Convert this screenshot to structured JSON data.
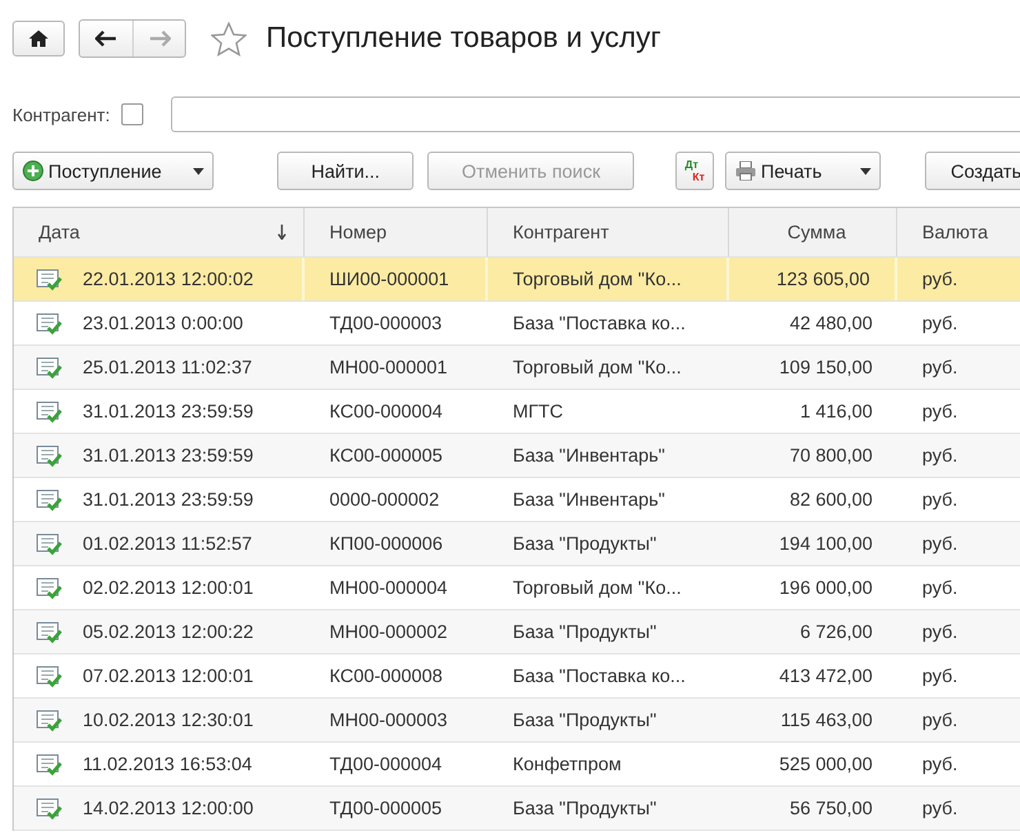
{
  "header": {
    "title": "Поступление товаров и услуг",
    "back_disabled": false,
    "forward_disabled": true,
    "favorite": false
  },
  "filter": {
    "label": "Контрагент:",
    "checked": false
  },
  "toolbar": [
    {
      "kind": "add-menu",
      "label": "Поступление",
      "disabled": false
    },
    {
      "kind": "button",
      "label": "Найти...",
      "disabled": false
    },
    {
      "kind": "button",
      "label": "Отменить поиск",
      "disabled": true
    },
    {
      "kind": "dtkt",
      "label": "Дт",
      "label2": "Кт",
      "disabled": false
    },
    {
      "kind": "print-menu",
      "label": "Печать",
      "disabled": false
    },
    {
      "kind": "button",
      "label": "Создать",
      "disabled": false
    }
  ],
  "table": {
    "columns": [
      {
        "label": "Дата",
        "sorted": true,
        "kind": "text"
      },
      {
        "label": "Номер",
        "sorted": false,
        "kind": "text"
      },
      {
        "label": "Контрагент",
        "sorted": false,
        "kind": "text"
      },
      {
        "label": "Сумма",
        "sorted": false,
        "kind": "number"
      },
      {
        "label": "Валюта",
        "sorted": false,
        "kind": "text"
      }
    ],
    "rows": [
      {
        "selected": true,
        "cells": [
          "22.01.2013 12:00:02",
          "ШИ00-000001",
          "Торговый дом \"Ко...",
          "123 605,00",
          "руб."
        ]
      },
      {
        "selected": false,
        "cells": [
          "23.01.2013 0:00:00",
          "ТД00-000003",
          "База \"Поставка ко...",
          "42 480,00",
          "руб."
        ]
      },
      {
        "selected": false,
        "cells": [
          "25.01.2013 11:02:37",
          "МН00-000001",
          "Торговый дом \"Ко...",
          "109 150,00",
          "руб."
        ]
      },
      {
        "selected": false,
        "cells": [
          "31.01.2013 23:59:59",
          "КС00-000004",
          "МГТС",
          "1 416,00",
          "руб."
        ]
      },
      {
        "selected": false,
        "cells": [
          "31.01.2013 23:59:59",
          "КС00-000005",
          "База \"Инвентарь\"",
          "70 800,00",
          "руб."
        ]
      },
      {
        "selected": false,
        "cells": [
          "31.01.2013 23:59:59",
          "0000-000002",
          "База \"Инвентарь\"",
          "82 600,00",
          "руб."
        ]
      },
      {
        "selected": false,
        "cells": [
          "01.02.2013 11:52:57",
          "КП00-000006",
          "База \"Продукты\"",
          "194 100,00",
          "руб."
        ]
      },
      {
        "selected": false,
        "cells": [
          "02.02.2013 12:00:01",
          "МН00-000004",
          "Торговый дом \"Ко...",
          "196 000,00",
          "руб."
        ]
      },
      {
        "selected": false,
        "cells": [
          "05.02.2013 12:00:22",
          "МН00-000002",
          "База \"Продукты\"",
          "6 726,00",
          "руб."
        ]
      },
      {
        "selected": false,
        "cells": [
          "07.02.2013 12:00:01",
          "КС00-000008",
          "База \"Поставка ко...",
          "413 472,00",
          "руб."
        ]
      },
      {
        "selected": false,
        "cells": [
          "10.02.2013 12:30:01",
          "МН00-000003",
          "База \"Продукты\"",
          "115 463,00",
          "руб."
        ]
      },
      {
        "selected": false,
        "cells": [
          "11.02.2013 16:53:04",
          "ТД00-000004",
          "Конфетпром",
          "525 000,00",
          "руб."
        ]
      },
      {
        "selected": false,
        "cells": [
          "14.02.2013 12:00:00",
          "ТД00-000005",
          "База \"Продукты\"",
          "56 750,00",
          "руб."
        ]
      }
    ]
  }
}
